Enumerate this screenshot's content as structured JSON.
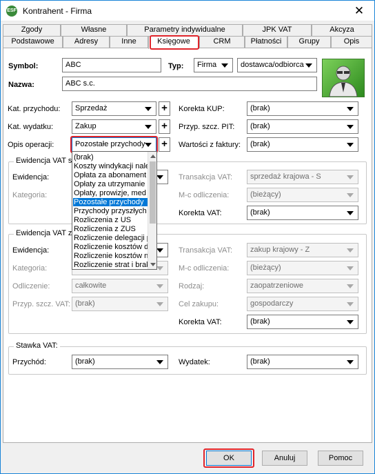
{
  "window": {
    "title": "Kontrahent - Firma",
    "icon": "app-logo-icon",
    "close": "close-icon"
  },
  "tabs_top": [
    "Zgody",
    "Własne",
    "Parametry indywidualne",
    "JPK VAT",
    "Akcyza"
  ],
  "tabs_bottom": [
    "Podstawowe",
    "Adresy",
    "Inne",
    "Księgowe",
    "CRM",
    "Płatności",
    "Grupy",
    "Opis"
  ],
  "active_tab": "Księgowe",
  "header": {
    "symbol_label": "Symbol:",
    "symbol_value": "ABC",
    "typ_label": "Typ:",
    "typ_value": "Firma",
    "typ2_value": "dostawca/odbiorca",
    "nazwa_label": "Nazwa:",
    "nazwa_value": "ABC s.c."
  },
  "left": {
    "kat_przychodu_label": "Kat. przychodu:",
    "kat_przychodu_value": "Sprzedaż",
    "kat_wydatku_label": "Kat. wydatku:",
    "kat_wydatku_value": "Zakup",
    "opis_label": "Opis operacji:",
    "opis_value": "Pozostałe przychody"
  },
  "right": {
    "korekta_kup_label": "Korekta KUP:",
    "korekta_kup_value": "(brak)",
    "przyp_pit_label": "Przyp. szcz. PIT:",
    "przyp_pit_value": "(brak)",
    "wartosc_label": "Wartości z faktury:",
    "wartosc_value": "(brak)"
  },
  "group1": {
    "title": "Ewidencja VAT sp",
    "ewidencja_label": "Ewidencja:",
    "kategoria_label": "Kategoria:",
    "transakcja_label": "Transakcja VAT:",
    "transakcja_value": "sprzedaż krajowa - S",
    "mc_label": "M-c odliczenia:",
    "mc_value": "(bieżący)",
    "korekta_label": "Korekta VAT:",
    "korekta_value": "(brak)"
  },
  "group2": {
    "title": "Ewidencja VAT za",
    "ewidencja_label": "Ewidencja:",
    "kategoria_label": "Kategoria:",
    "odliczenie_label": "Odliczenie:",
    "odliczenie_value": "całkowite",
    "przyp_vat_label": "Przyp. szcz. VAT:",
    "przyp_vat_value": "(brak)",
    "transakcja_label": "Transakcja VAT:",
    "transakcja_value": "zakup krajowy - Z",
    "mc_label": "M-c odliczenia:",
    "mc_value": "(bieżący)",
    "rodzaj_label": "Rodzaj:",
    "rodzaj_value": "zaopatrzeniowe",
    "cel_label": "Cel zakupu:",
    "cel_value": "gospodarczy",
    "korekta_label": "Korekta VAT:",
    "korekta_value": "(brak)"
  },
  "group3": {
    "title": "Stawka VAT:",
    "przychod_label": "Przychód:",
    "przychod_value": "(brak)",
    "wydatek_label": "Wydatek:",
    "wydatek_value": "(brak)"
  },
  "dropdown": {
    "items": [
      "(brak)",
      "Koszty windykacji należ",
      "Opłata za abonament",
      "Opłaty za utrzymanie",
      "Opłaty, prowizje, med",
      "Pozostałe przychody",
      "Przychody przyszłych",
      "Rozliczenia z US",
      "Rozliczenia z ZUS",
      "Rozliczenie delegacji p",
      "Rozliczenie kosztów do",
      "Rozliczenie kosztów na",
      "Rozliczenie strat i brak"
    ],
    "selected": "Pozostałe przychody"
  },
  "buttons": {
    "ok": "OK",
    "anuluj": "Anuluj",
    "pomoc": "Pomoc"
  },
  "colors": {
    "highlight": "#e0242b",
    "selection": "#0078d7",
    "avatar": "#4caf3a"
  }
}
